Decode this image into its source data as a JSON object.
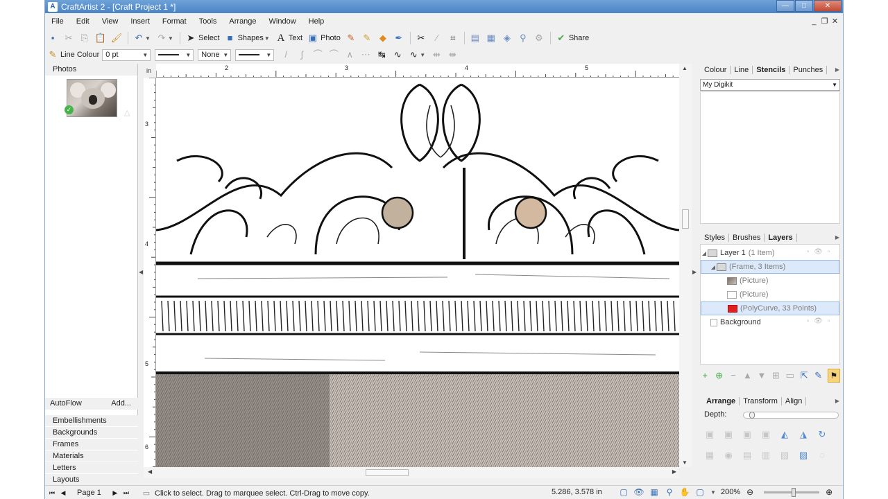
{
  "window": {
    "title": "CraftArtist 2 - [Craft Project 1 *]",
    "app_icon_letter": "A",
    "caption_minimize": "—",
    "caption_maximize": "□",
    "caption_close": "✕"
  },
  "menubar": {
    "items": [
      "File",
      "Edit",
      "View",
      "Insert",
      "Format",
      "Tools",
      "Arrange",
      "Window",
      "Help"
    ],
    "doc_minimize": "_",
    "doc_restore": "❐",
    "doc_close": "✕"
  },
  "toolbar_main": {
    "select_label": "Select",
    "shapes_label": "Shapes",
    "text_label": "Text",
    "photo_label": "Photo",
    "share_label": "Share"
  },
  "toolbar_context": {
    "line_colour_label": "Line Colour",
    "line_width_value": "0 pt",
    "arrow_style_value": "None"
  },
  "left_panel": {
    "title": "Photos",
    "autoflow_label": "AutoFlow",
    "add_label": "Add...",
    "categories": [
      "Embellishments",
      "Backgrounds",
      "Frames",
      "Materials",
      "Letters",
      "Layouts"
    ]
  },
  "workspace": {
    "ruler_unit": "in",
    "ruler_top_numbers": [
      "2",
      "3",
      "4",
      "5"
    ],
    "ruler_left_numbers": [
      "3",
      "4",
      "5",
      "6"
    ]
  },
  "stencil_panel": {
    "tabs": [
      "Colour",
      "Line",
      "Stencils",
      "Punches"
    ],
    "active_tab": "Stencils",
    "dropdown_value": "My Digikit"
  },
  "layers_panel": {
    "tabs": [
      "Styles",
      "Brushes",
      "Layers"
    ],
    "active_tab": "Layers",
    "rows": [
      {
        "label": "Layer 1",
        "count": "(1 Item)"
      },
      {
        "label": "(Frame, 3 Items)"
      },
      {
        "label": "(Picture)"
      },
      {
        "label": "(Picture)"
      },
      {
        "label": "(PolyCurve, 33 Points)"
      },
      {
        "label": "Background"
      }
    ]
  },
  "arrange_panel": {
    "tabs": [
      "Arrange",
      "Transform",
      "Align"
    ],
    "active_tab": "Arrange",
    "depth_label": "Depth:"
  },
  "statusbar": {
    "page_label": "Page 1",
    "hint": "Click to select. Drag to marquee select. Ctrl-Drag to move copy.",
    "coords": "5.286, 3.578 in",
    "zoom": "200%"
  },
  "colors": {
    "titlebar": "#4b84c4",
    "selection": "#dbe9fa",
    "polycurve_swatch": "#e02020"
  }
}
